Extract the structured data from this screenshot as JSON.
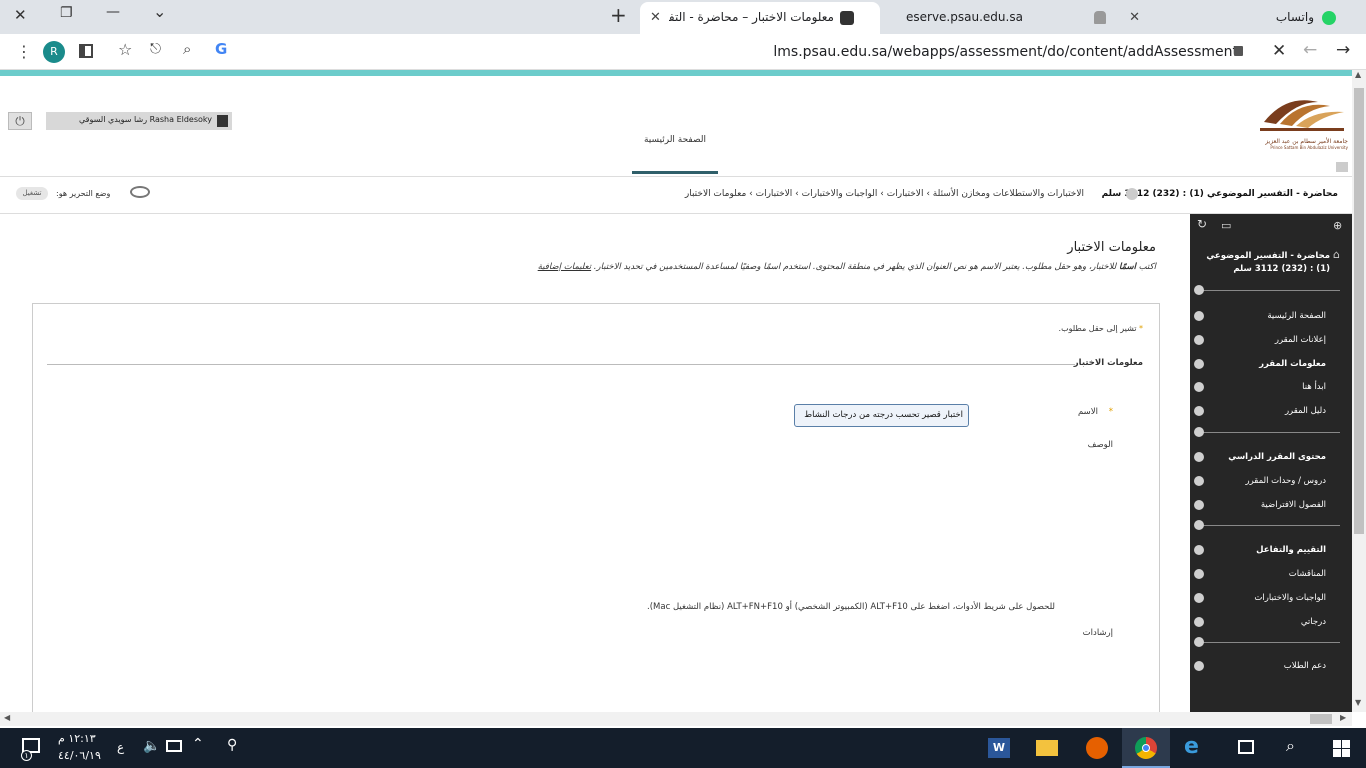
{
  "browser": {
    "tabs": [
      {
        "title": "واتساب",
        "icon": "whatsapp-icon",
        "state": "inactive"
      },
      {
        "title": "eserve.psau.edu.sa",
        "icon": "bell-icon",
        "state": "inactive"
      },
      {
        "title": "معلومات الاختبار – محاضرة - التفسير",
        "icon": "blackboard-icon",
        "state": "active"
      }
    ],
    "new_tab": "+",
    "url": "lms.psau.edu.sa/webapps/assessment/do/content/addAssessment",
    "profile_initial": "R",
    "window_controls": {
      "close": "✕",
      "restore": "❐",
      "minimize": "—",
      "tabs_menu": "⌄"
    }
  },
  "header": {
    "user_name": "رشا سويدي السوقي Rasha Eldesoky",
    "home_tab": "الصفحة الرئيسية",
    "logo_text": "جامعة الأمير سطام بن عبد العزيز",
    "logo_text_en": "Prince Sattam Bin Abdulaziz University"
  },
  "breadcrumb": {
    "course": "محاضرة - التفسير الموضوعي (1) : (232) 3112 سلم",
    "items": [
      "الاختبارات والاستطلاعات ومخازن الأسئلة",
      "الاختبارات",
      "الواجبات والاختبارات",
      "الاختبارات",
      "معلومات الاختبار"
    ],
    "edit_mode_label": "وضع التحرير هو:",
    "edit_mode_value": "تشغيل"
  },
  "sidebar": {
    "course_title": "محاضرة - التفسير الموضوعي (1) : (232) 3112 سلم",
    "items": [
      {
        "label": "الصفحة الرئيسية",
        "bold": false
      },
      {
        "label": "إعلانات المقرر",
        "bold": false
      },
      {
        "label": "معلومات المقرر",
        "bold": true
      },
      {
        "label": "ابدأ هنا",
        "bold": false
      },
      {
        "label": "دليل المقرر",
        "bold": false
      },
      {
        "label": "محتوى المقرر الدراسي",
        "bold": true
      },
      {
        "label": "دروس / وحدات المقرر",
        "bold": false
      },
      {
        "label": "الفصول الافتراضية",
        "bold": false
      },
      {
        "label": "التقييم والتفاعل",
        "bold": true
      },
      {
        "label": "المناقشات",
        "bold": false
      },
      {
        "label": "الواجبات والاختبارات",
        "bold": false
      },
      {
        "label": "درجاتي",
        "bold": false
      },
      {
        "label": "دعم الطلاب",
        "bold": false
      }
    ]
  },
  "main": {
    "page_title": "معلومات الاختبار",
    "instructions_pre": "اكتب",
    "instructions_bold": "اسمًا",
    "instructions_post": "للاختبار، وهو حقل مطلوب. يعتبر الاسم هو نص العنوان الذي يظهر في منطقة المحتوى. استخدم اسمًا وصفيًا لمساعدة المستخدمين في تحديد الاختبار.",
    "more_help": "تعليمات إضافية",
    "required_note": "تشير إلى حقل مطلوب.",
    "section_title": "معلومات الاختبار",
    "name_label": "الاسم",
    "name_value": "اختبار قصير تحسب درجته من درجات النشاط",
    "description_label": "الوصف",
    "toolbar_hint": "للحصول على شريط الأدوات، اضغط على ALT+F10 (الكمبيوتر الشخصي) أو ALT+FN+F10 (نظام التشغيل Mac).",
    "instructions_label": "إرشادات"
  },
  "taskbar": {
    "time": "١٢:١٣ م",
    "date": "٤٤/٠٦/١٩",
    "lang": "ع",
    "notification_count": "١"
  },
  "colors": {
    "accent_teal": "#6ccccb",
    "sidebar_bg": "#262626",
    "taskbar_bg": "#141e2b",
    "home_underline": "#2f5f6a"
  }
}
